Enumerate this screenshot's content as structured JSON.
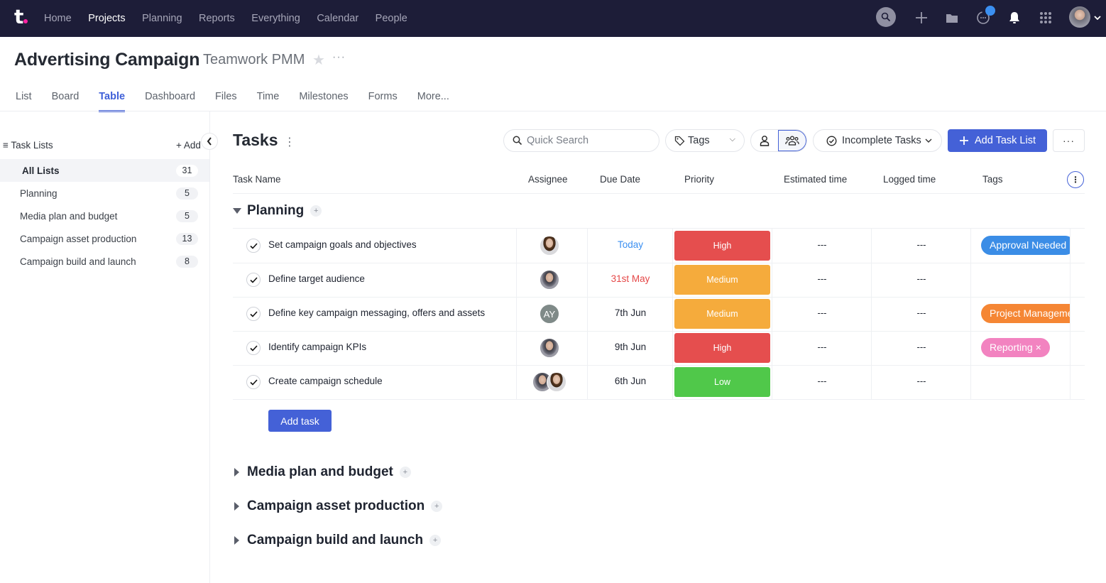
{
  "topnav": {
    "logo_text": "t",
    "items": [
      "Home",
      "Projects",
      "Planning",
      "Reports",
      "Everything",
      "Calendar",
      "People"
    ],
    "active_index": 1,
    "icons": [
      "search-icon",
      "plus-icon",
      "folder-icon",
      "chat-icon",
      "bell-icon",
      "apps-grid-icon",
      "user-avatar",
      "chevron-down-icon"
    ],
    "notification_badge_color": "#3b8ff1"
  },
  "project": {
    "title": "Advertising Campaign",
    "company": "Teamwork PMM",
    "star": "★",
    "more": "···"
  },
  "tabs": {
    "items": [
      "List",
      "Board",
      "Table",
      "Dashboard",
      "Files",
      "Time",
      "Milestones",
      "Forms",
      "More..."
    ],
    "active_index": 2
  },
  "sidebar": {
    "heading": "Task Lists",
    "heading_icon": "≡",
    "add_label": "+ Add",
    "collapse_icon": "‹",
    "items": [
      {
        "label": "All Lists",
        "count": "31",
        "active": true
      },
      {
        "label": "Planning",
        "count": "5"
      },
      {
        "label": "Media plan and budget",
        "count": "5"
      },
      {
        "label": "Campaign asset production",
        "count": "13"
      },
      {
        "label": "Campaign build and launch",
        "count": "8"
      }
    ]
  },
  "toolbar": {
    "title": "Tasks",
    "kebab": "⋮",
    "search_placeholder": "Quick Search",
    "tags_label": "Tags",
    "filter_label": "Incomplete Tasks",
    "add_list_label": "Add Task List",
    "more_label": "···"
  },
  "table": {
    "columns": [
      "Task Name",
      "Assignee",
      "Due Date",
      "Priority",
      "Estimated time",
      "Logged time",
      "Tags"
    ],
    "column_menu_icon": "⋮",
    "priority_colors": {
      "High": "#e54e4e",
      "Medium": "#f5ab3c",
      "Low": "#50c84a"
    },
    "groups": [
      {
        "title": "Planning",
        "expanded": true,
        "tasks": [
          {
            "name": "Set campaign goals and objectives",
            "assignees": [
              "female"
            ],
            "due": "Today",
            "due_state": "today",
            "priority": "High",
            "estimated": "---",
            "logged": "---",
            "tag": {
              "label": "Approval Needed",
              "color": "#3b8de6"
            }
          },
          {
            "name": "Define target audience",
            "assignees": [
              "male"
            ],
            "due": "31st May",
            "due_state": "overdue",
            "priority": "Medium",
            "estimated": "---",
            "logged": "---",
            "tag": null
          },
          {
            "name": "Define key campaign messaging, offers and assets",
            "assignees": [
              "initials:AY"
            ],
            "due": "7th Jun",
            "due_state": "normal",
            "priority": "Medium",
            "estimated": "---",
            "logged": "---",
            "tag": {
              "label": "Project Management",
              "color": "#f58634"
            }
          },
          {
            "name": "Identify campaign KPIs",
            "assignees": [
              "male"
            ],
            "due": "9th Jun",
            "due_state": "normal",
            "priority": "High",
            "estimated": "---",
            "logged": "---",
            "tag": {
              "label": "Reporting ×",
              "color": "#f283c0"
            }
          },
          {
            "name": "Create campaign schedule",
            "assignees": [
              "male",
              "female"
            ],
            "due": "6th Jun",
            "due_state": "normal",
            "priority": "Low",
            "estimated": "---",
            "logged": "---",
            "tag": null
          }
        ],
        "add_task_label": "Add task"
      },
      {
        "title": "Media plan and budget",
        "expanded": false
      },
      {
        "title": "Campaign asset production",
        "expanded": false
      },
      {
        "title": "Campaign build and launch",
        "expanded": false
      }
    ]
  }
}
